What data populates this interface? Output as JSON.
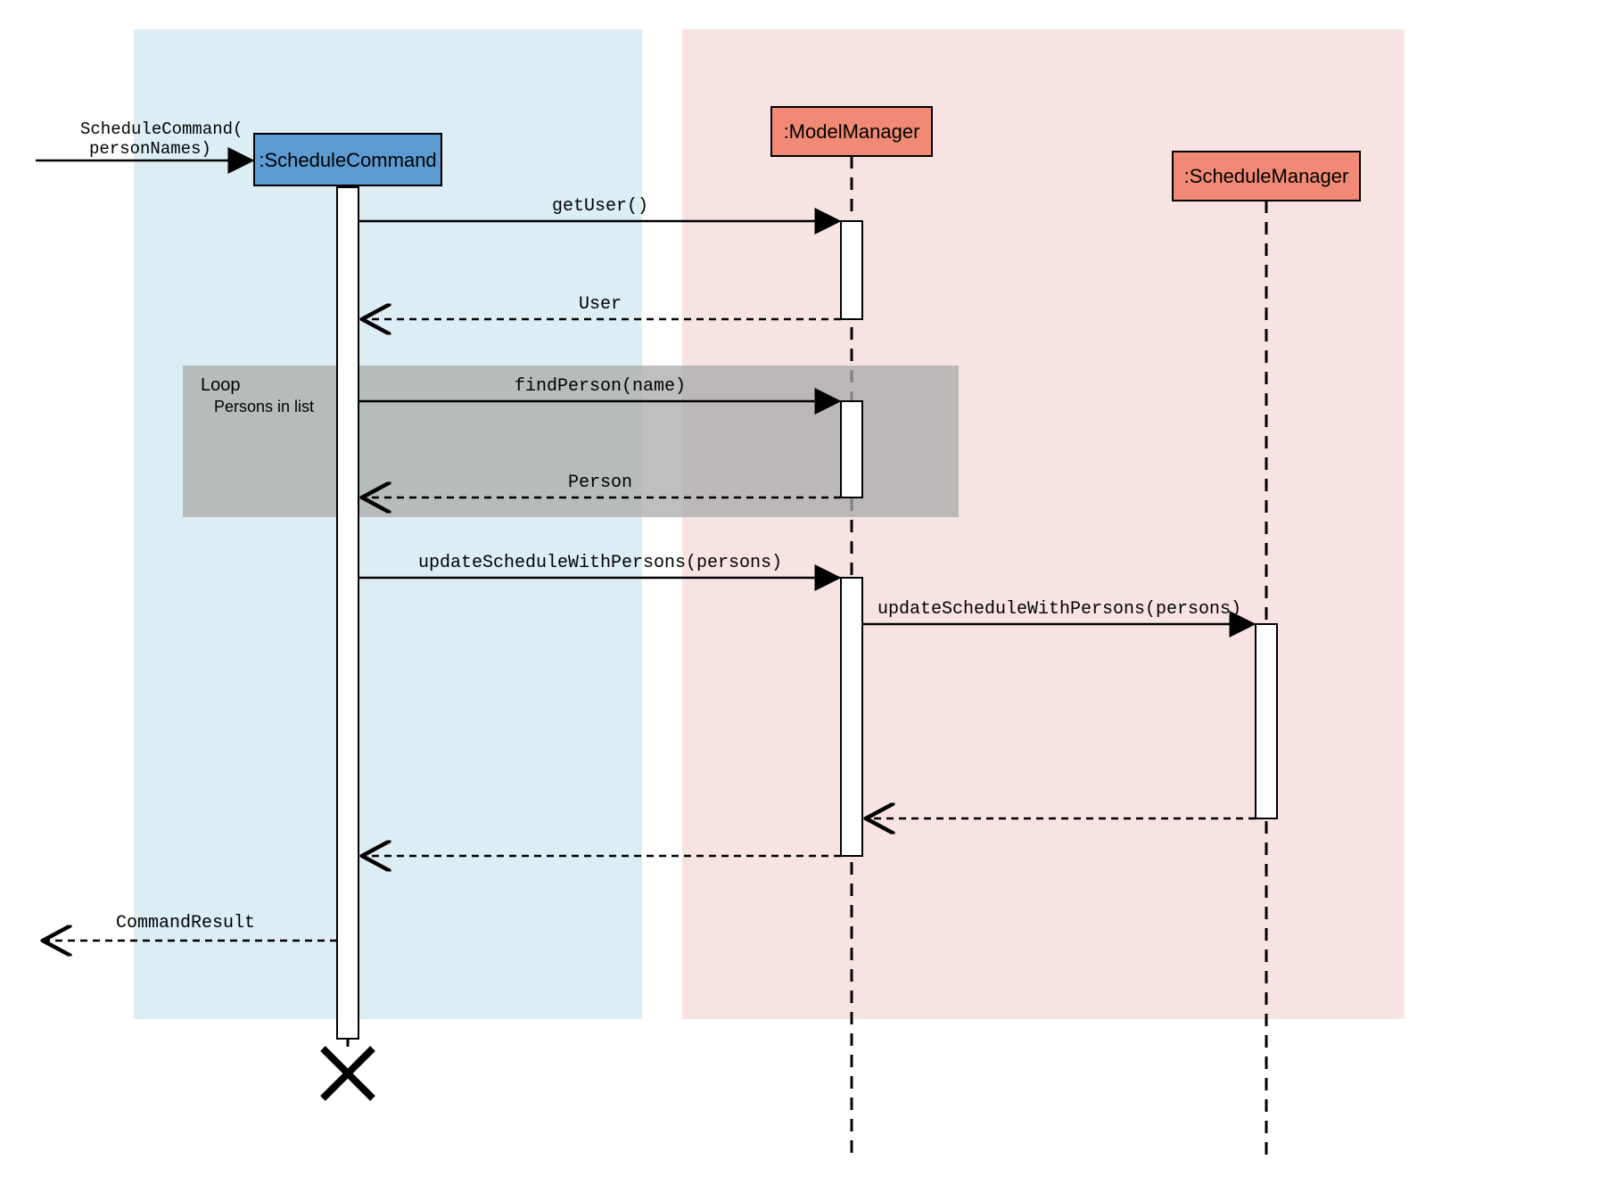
{
  "lifelines": {
    "scheduleCommand": ":ScheduleCommand",
    "modelManager": ":ModelManager",
    "scheduleManager": ":ScheduleManager"
  },
  "messages": {
    "entry1": "ScheduleCommand(",
    "entry2": "personNames)",
    "getUser": "getUser()",
    "userReturn": "User",
    "findPerson": "findPerson(name)",
    "personReturn": "Person",
    "updateSchedule1": "updateScheduleWithPersons(persons)",
    "updateSchedule2": "updateScheduleWithPersons(persons)",
    "commandResult": "CommandResult"
  },
  "loop": {
    "title": "Loop",
    "subtitle": "Persons in list"
  }
}
